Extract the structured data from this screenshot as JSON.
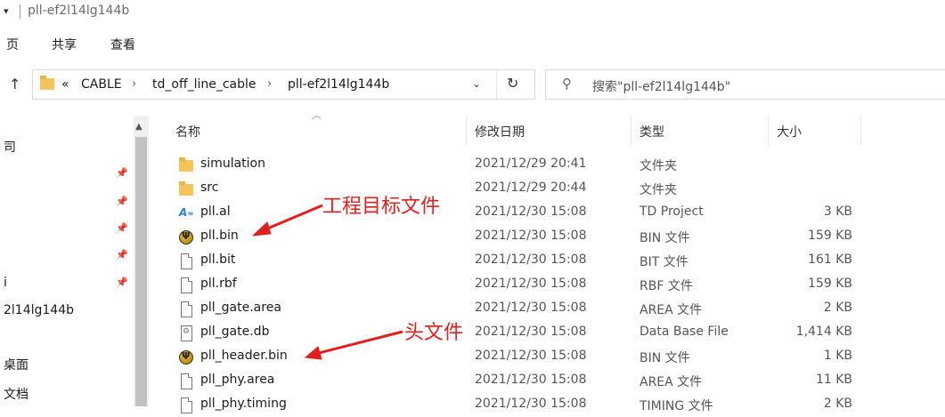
{
  "window": {
    "title": "pll-ef2l14lg144b",
    "quick_access": "▾"
  },
  "ribbon": {
    "tabs": [
      "页",
      "共享",
      "查看"
    ]
  },
  "address": {
    "overflow": "«",
    "crumbs": [
      "CABLE",
      "td_off_line_cable",
      "pll-ef2l14lg144b"
    ],
    "search_placeholder": "搜索\"pll-ef2l14lg144b\""
  },
  "nav": {
    "items": [
      {
        "label": "司",
        "pinned": false
      },
      {
        "label": "",
        "pinned": true
      },
      {
        "label": "",
        "pinned": true
      },
      {
        "label": "",
        "pinned": true
      },
      {
        "label": "",
        "pinned": true
      },
      {
        "label": "i",
        "pinned": true
      },
      {
        "label": "2l14lg144b",
        "pinned": false
      },
      {
        "label": "桌面",
        "pinned": false
      },
      {
        "label": "文档",
        "pinned": false
      }
    ]
  },
  "columns": {
    "name": "名称",
    "date": "修改日期",
    "type": "类型",
    "size": "大小"
  },
  "files": [
    {
      "icon": "folder-icon",
      "name": "simulation",
      "date": "2021/12/29 20:41",
      "type": "文件夹",
      "size": ""
    },
    {
      "icon": "folder-icon",
      "name": "src",
      "date": "2021/12/29 20:44",
      "type": "文件夹",
      "size": ""
    },
    {
      "icon": "td-project-icon",
      "name": "pll.al",
      "date": "2021/12/30 15:08",
      "type": "TD Project",
      "size": "3 KB"
    },
    {
      "icon": "bin-file-icon",
      "name": "pll.bin",
      "date": "2021/12/30 15:08",
      "type": "BIN 文件",
      "size": "159 KB"
    },
    {
      "icon": "document-icon",
      "name": "pll.bit",
      "date": "2021/12/30 15:08",
      "type": "BIT 文件",
      "size": "161 KB"
    },
    {
      "icon": "document-icon",
      "name": "pll.rbf",
      "date": "2021/12/30 15:08",
      "type": "RBF 文件",
      "size": "159 KB"
    },
    {
      "icon": "document-icon",
      "name": "pll_gate.area",
      "date": "2021/12/30 15:08",
      "type": "AREA 文件",
      "size": "2 KB"
    },
    {
      "icon": "database-file-icon",
      "name": "pll_gate.db",
      "date": "2021/12/30 15:08",
      "type": "Data Base File",
      "size": "1,414 KB"
    },
    {
      "icon": "bin-file-icon",
      "name": "pll_header.bin",
      "date": "2021/12/30 15:08",
      "type": "BIN 文件",
      "size": "1 KB"
    },
    {
      "icon": "document-icon",
      "name": "pll_phy.area",
      "date": "2021/12/30 15:08",
      "type": "AREA 文件",
      "size": "11 KB"
    },
    {
      "icon": "document-icon",
      "name": "pll_phy.timing",
      "date": "2021/12/30 15:08",
      "type": "TIMING 文件",
      "size": "2 KB"
    }
  ],
  "annotations": {
    "project_target": "工程目标文件",
    "header_file": "头文件",
    "color": "#e11f1f"
  }
}
